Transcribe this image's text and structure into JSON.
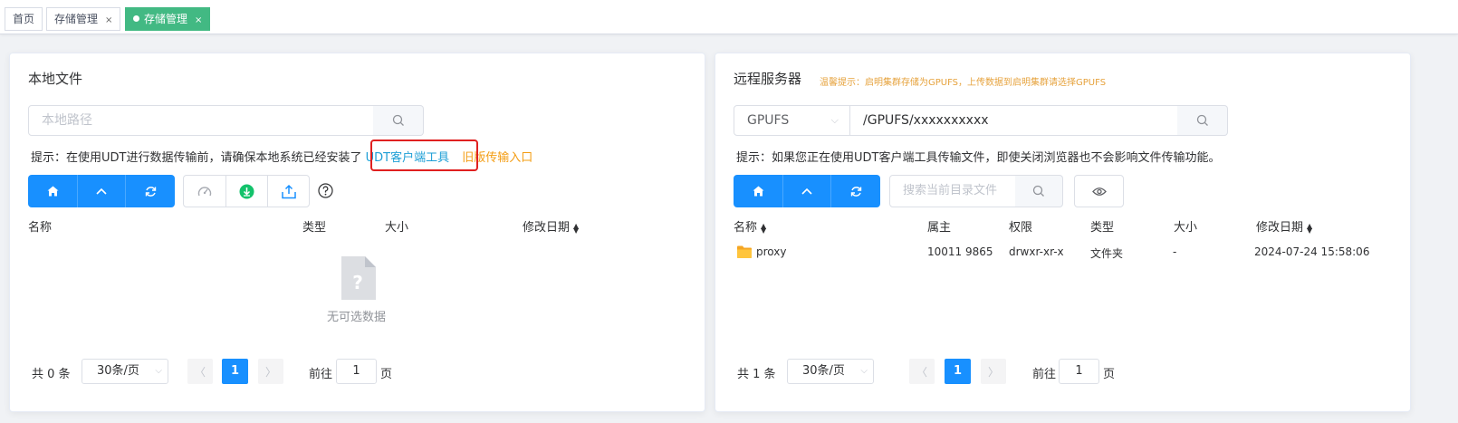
{
  "tabs": [
    {
      "label": "首页",
      "closable": false,
      "active": false
    },
    {
      "label": "存储管理",
      "closable": true,
      "active": false
    },
    {
      "label": "存储管理",
      "closable": true,
      "active": true
    }
  ],
  "close_glyph": "×",
  "local": {
    "title": "本地文件",
    "path_placeholder": "本地路径",
    "hint_prefix": "提示：在使用UDT进行数据传输前，请确保本地系统已经安装了",
    "hint_link": "UDT客户端工具",
    "hint_old_entry": "旧版传输入口",
    "toolbar": {
      "nav_icons": [
        "home-icon",
        "up-icon",
        "refresh-icon"
      ],
      "action_icons": [
        "speed-icon",
        "download-icon",
        "upload-icon"
      ],
      "help_icon": "question-icon"
    },
    "columns": [
      "名称",
      "类型",
      "大小",
      "修改日期"
    ],
    "empty_text": "无可选数据",
    "pager": {
      "total": "共 0 条",
      "page_size": "30条/页",
      "current": "1",
      "goto_prefix": "前往",
      "goto_value": "1",
      "goto_suffix": "页"
    }
  },
  "remote": {
    "title": "远程服务器",
    "warning": "温馨提示：启明集群存储为GPUFS，上传数据到启明集群请选择GPUFS",
    "fs_select": "GPUFS",
    "path_value": "/GPUFS/xxxxxxxxxx",
    "hint": "提示：如果您正在使用UDT客户端工具传输文件，即使关闭浏览器也不会影响文件传输功能。",
    "search_placeholder": "搜索当前目录文件",
    "columns": [
      "名称",
      "属主",
      "权限",
      "类型",
      "大小",
      "修改日期"
    ],
    "rows": [
      {
        "name": "proxy",
        "owner": "10011 9865",
        "perm": "drwxr-xr-x",
        "type": "文件夹",
        "size": "-",
        "modified": "2024-07-24 15:58:06"
      }
    ],
    "pager": {
      "total": "共 1 条",
      "page_size": "30条/页",
      "current": "1",
      "goto_prefix": "前往",
      "goto_value": "1",
      "goto_suffix": "页"
    }
  },
  "colors": {
    "primary": "#1890ff",
    "active_tab": "#42b983",
    "warning": "#e6a23c",
    "highlight": "#e02020"
  }
}
